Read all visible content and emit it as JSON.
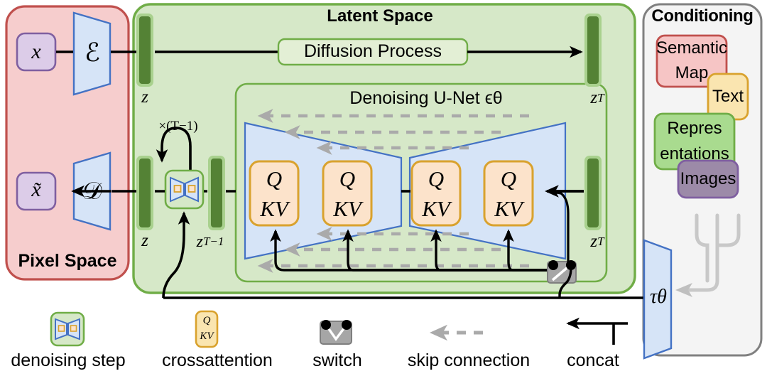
{
  "figure": {
    "kind": "latent-diffusion-architecture",
    "panels": {
      "pixel_space": {
        "title": "Pixel Space",
        "fill": "#F6CDCD",
        "stroke": "#C0504D"
      },
      "latent_space": {
        "title": "Latent Space",
        "fill": "#D6E8C8",
        "stroke": "#70AD47"
      },
      "conditioning": {
        "title": "Conditioning",
        "fill": "#F4F4F4",
        "stroke": "#808080"
      }
    },
    "pixel_space_nodes": {
      "input_latent": "x",
      "output_latent": "x̃",
      "encoder": "ℰ",
      "decoder": "𝒟",
      "box_fill": "#DCCCE8",
      "box_stroke": "#7F5FA0",
      "trapezoid_fill": "#D6E4F7",
      "trapezoid_stroke": "#4472C4"
    },
    "latent_nodes": {
      "bar_label_z_top": "z",
      "bar_label_z_bottom": "z",
      "bar_label_zT_top": "z_T",
      "bar_label_zT_bottom": "z_T",
      "bar_label_zT_minus_1": "z_{T-1}",
      "bar_fill": "#548235",
      "bar_outline": "#A9D18E",
      "diffusion_process": "Diffusion Process",
      "loop_label": "×(T−1)"
    },
    "unet": {
      "title": "Denoising U-Net ϵθ",
      "fill": "#D6E4F7",
      "stroke": "#4472C4",
      "attention_blocks": [
        {
          "q": "Q",
          "kv": "KV"
        },
        {
          "q": "Q",
          "kv": "KV"
        },
        {
          "q": "Q",
          "kv": "KV"
        },
        {
          "q": "Q",
          "kv": "KV"
        }
      ],
      "attention_fill": "#FCE3CB",
      "attention_stroke": "#D9A22E",
      "skip_connection_count_top": 3,
      "skip_connection_count_bottom": 3,
      "skip_color": "#AAAAAA"
    },
    "conditioning_items": [
      {
        "label": "Semantic\nMap",
        "line1": "Semantic",
        "line2": "Map",
        "fill": "#F6C5C5",
        "stroke": "#C0504D"
      },
      {
        "label": "Text",
        "line1": "Text",
        "line2": "",
        "fill": "#FAE5B0",
        "stroke": "#D9A22E"
      },
      {
        "label": "Repres\nentations",
        "line1": "Repres",
        "line2": "entations",
        "fill": "#A9DB8F",
        "stroke": "#70AD47"
      },
      {
        "label": "Images",
        "line1": "Images",
        "line2": "",
        "fill": "#9C8AA8",
        "stroke": "#7F5FA0"
      }
    ],
    "conditioning_encoder": "τθ",
    "legend": [
      {
        "icon": "denoising-step-icon",
        "label": "denoising step"
      },
      {
        "icon": "crossattention-icon",
        "label": "crossattention"
      },
      {
        "icon": "switch-icon",
        "label": "switch"
      },
      {
        "icon": "skip-connection-icon",
        "label": "skip connection"
      },
      {
        "icon": "concat-icon",
        "label": "concat"
      }
    ]
  }
}
